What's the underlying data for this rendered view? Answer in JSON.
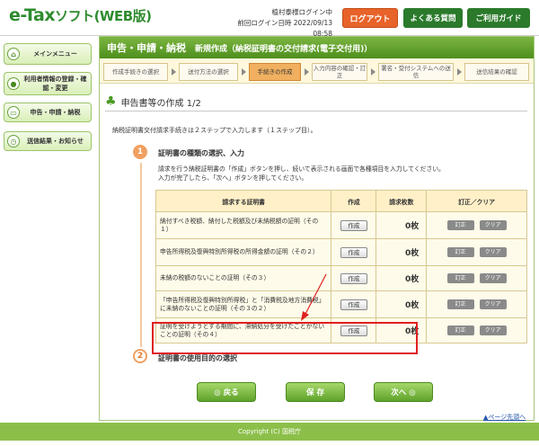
{
  "header": {
    "logo_main": "e-Tax",
    "logo_sub": "ソフト(WEB版)",
    "user_name": "植村泰様ログイン中",
    "last_login_label": "前回ログイン日時",
    "last_login_value": "2022/09/13 08:58",
    "logout": "ログアウト",
    "faq": "よくある質問",
    "guide": "ご利用ガイド"
  },
  "sidebar": {
    "items": [
      {
        "label": "メインメニュー",
        "icon": "house-icon"
      },
      {
        "label": "利用者情報の登録・確認・変更",
        "icon": "person-icon"
      },
      {
        "label": "申告・申請・納税",
        "icon": "document-icon"
      },
      {
        "label": "送信結果・お知らせ",
        "icon": "clock-icon"
      }
    ]
  },
  "title": {
    "main": "申告・申請・納税",
    "sub": "新規作成（納税証明書の交付請求(電子交付用)）"
  },
  "steps": [
    {
      "label": "作成手続きの選択"
    },
    {
      "label": "送付方法の選択"
    },
    {
      "label": "手続きの作成"
    },
    {
      "label": "入力内容の確認・訂正"
    },
    {
      "label": "署名・受付システムへの送信"
    },
    {
      "label": "送信結果の確認"
    }
  ],
  "section_title": "申告書等の作成 1/2",
  "description": "納税証明書交付請求手続きは２ステップで入力します（１ステップ目）。",
  "step1": {
    "num": "1",
    "heading": "証明書の種類の選択、入力",
    "instruction1": "請求を行う納税証明書の「作成」ボタンを押し、続いて表示される画面で各種項目を入力してください。",
    "instruction2": "入力が完了したら、「次へ」ボタンを押してください。"
  },
  "table": {
    "headers": [
      "請求する証明書",
      "作成",
      "請求枚数",
      "訂正／クリア"
    ],
    "make_label": "作成",
    "edit_label": "訂正",
    "clear_label": "クリア",
    "rows": [
      {
        "name": "納付すべき税額、納付した税額及び未納税額の証明（その１）",
        "count": "0枚"
      },
      {
        "name": "申告所得税及復興特別所得税の所得金額の証明（その２）",
        "count": "0枚"
      },
      {
        "name": "未納の税額のないことの証明（その３）",
        "count": "0枚"
      },
      {
        "name": "「申告所得税及復興特別所得税」と「消費税及地方消費税」に未納のないことの証明（その３の２）",
        "count": "0枚"
      },
      {
        "name": "証明を受けようとする期間に、滞納処分を受けたことがないことの証明（その４）",
        "count": "0枚"
      }
    ]
  },
  "step2": {
    "num": "2",
    "heading": "証明書の使用目的の選択"
  },
  "nav": {
    "back": "◎ 戻る",
    "save": "保 存",
    "next": "次へ ◎"
  },
  "page_top": "ページ先頭へ",
  "footer": "Copyright (C) 国税庁",
  "colors": {
    "green_dark": "#4e8f1e",
    "orange": "#e8632a",
    "highlight_red": "#e02020"
  }
}
